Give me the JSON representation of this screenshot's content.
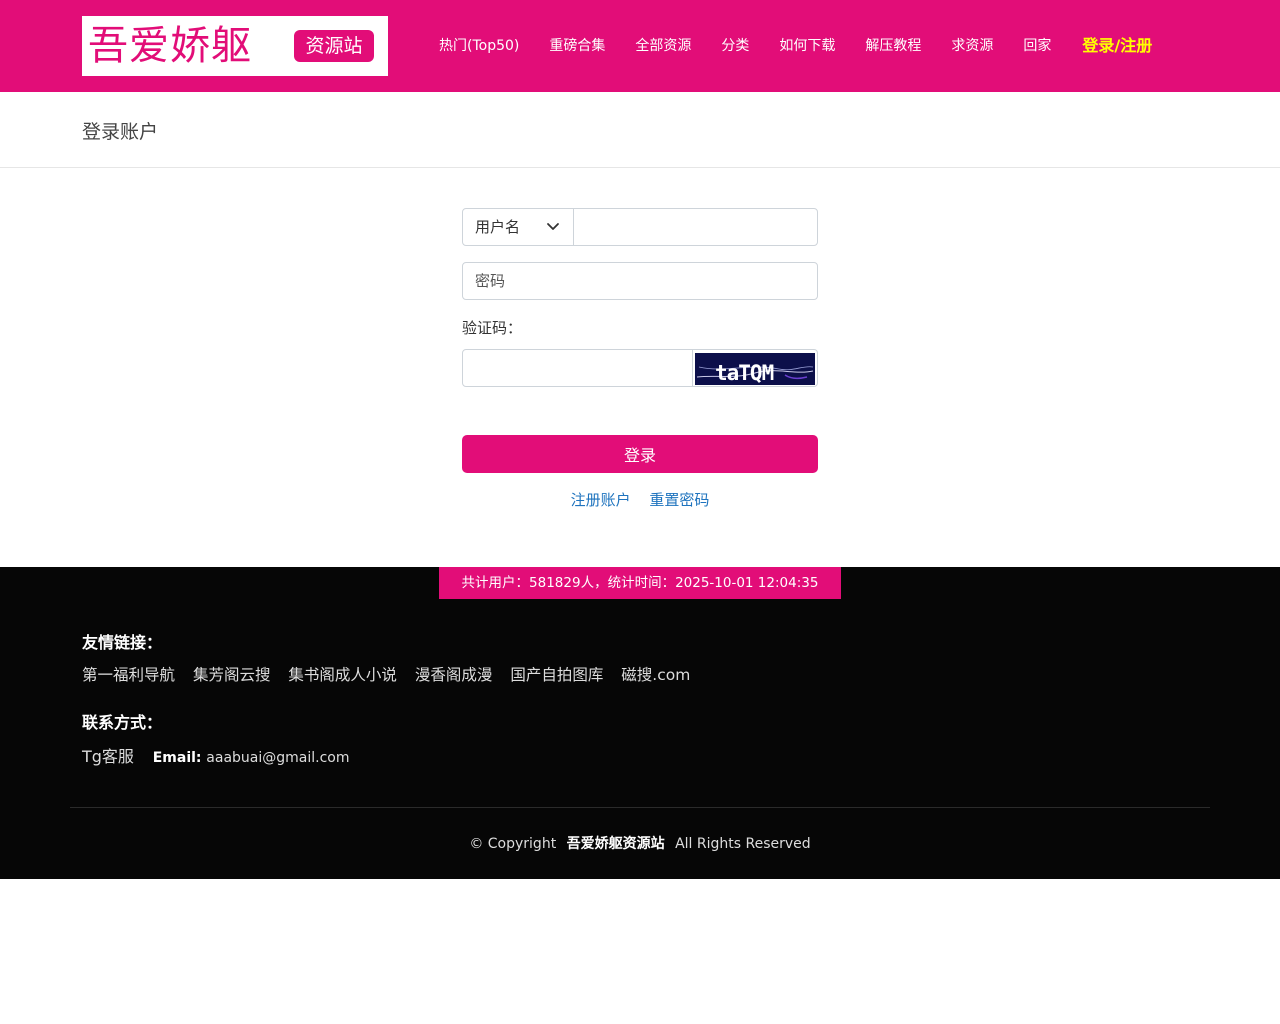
{
  "header": {
    "logo_text": "吾爱娇躯",
    "logo_badge": "资源站",
    "nav": [
      {
        "label": "热门(Top50)"
      },
      {
        "label": "重磅合集"
      },
      {
        "label": "全部资源"
      },
      {
        "label": "分类"
      },
      {
        "label": "如何下载"
      },
      {
        "label": "解压教程"
      },
      {
        "label": "求资源"
      },
      {
        "label": "回家"
      }
    ],
    "login_label": "登录/注册",
    "login_color": "#ffff00",
    "brand_color": "#e20d78"
  },
  "page": {
    "title": "登录账户"
  },
  "form": {
    "account_type": "用户名",
    "account_value": "",
    "password_placeholder": "密码",
    "captcha_label": "验证码：",
    "captcha_value": "",
    "captcha_text": "taTQM",
    "submit_label": "登录",
    "register_link": "注册账户",
    "reset_link": "重置密码"
  },
  "footer": {
    "stats": "共计用户：581829人，统计时间：2025-10-01 12:04:35",
    "friends_heading": "友情链接：",
    "friend_links": [
      "第一福利导航",
      "集芳阁云搜",
      "集书阁成人小说",
      "漫香阁成漫",
      "国产自拍图库",
      "磁搜.com"
    ],
    "contact_heading": "联系方式：",
    "contact_tg": "Tg客服",
    "email_label": "Email:",
    "email_value": "aaabuai@gmail.com",
    "copyright_prefix": "© Copyright",
    "site_name": "吾爱娇躯资源站",
    "copyright_suffix": "All Rights Reserved"
  }
}
